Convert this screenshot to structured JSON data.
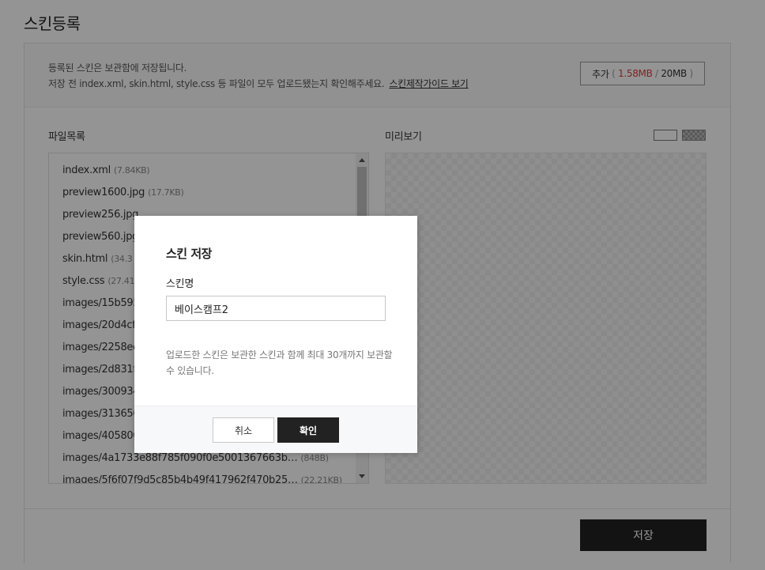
{
  "page": {
    "title": "스킨등록"
  },
  "notice": {
    "line1": "등록된 스킨은 보관함에 저장됩니다.",
    "line2": "저장 전 index.xml, skin.html, style.css 등 파일이 모두 업로드됐는지 확인해주세요.",
    "guide_link": "스킨제작가이드 보기"
  },
  "add_button": {
    "label": "추가",
    "open": "(",
    "used": "1.58MB",
    "sep": "/",
    "limit": "20MB",
    "close": ")"
  },
  "files": {
    "label": "파일목록",
    "items": [
      {
        "name": "index.xml",
        "size": "(7.84KB)"
      },
      {
        "name": "preview1600.jpg",
        "size": "(17.7KB)"
      },
      {
        "name": "preview256.jpg",
        "size": ""
      },
      {
        "name": "preview560.jpg",
        "size": ""
      },
      {
        "name": "skin.html",
        "size": "(34.3"
      },
      {
        "name": "style.css",
        "size": "(27.41"
      },
      {
        "name": "images/15b595",
        "size": ""
      },
      {
        "name": "images/20d4cfe",
        "size": ""
      },
      {
        "name": "images/2258ee2",
        "size": ""
      },
      {
        "name": "images/2d831f2",
        "size": ""
      },
      {
        "name": "images/300934",
        "size": ""
      },
      {
        "name": "images/313656",
        "size": ""
      },
      {
        "name": "images/405800",
        "size": ""
      },
      {
        "name": "images/4a1733e88f785f090f0e5001367663b…",
        "size": "(848B)"
      },
      {
        "name": "images/5f6f07f9d5c85b4b49f417962f470b25…",
        "size": "(22.21KB)"
      }
    ]
  },
  "preview": {
    "label": "미리보기"
  },
  "footer": {
    "save_label": "저장"
  },
  "modal": {
    "title": "스킨 저장",
    "field_label": "스킨명",
    "input_value": "베이스캠프2",
    "description": "업로드한 스킨은 보관한 스킨과 함께 최대 30개까지 보관할 수 있습니다.",
    "cancel_label": "취소",
    "ok_label": "확인"
  }
}
